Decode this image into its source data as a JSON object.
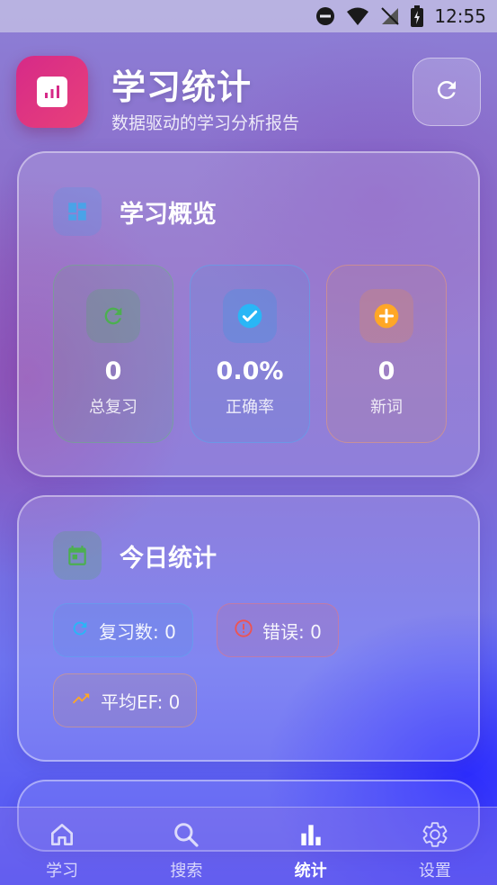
{
  "status_bar": {
    "time": "12:55"
  },
  "header": {
    "title": "学习统计",
    "subtitle": "数据驱动的学习分析报告",
    "logo_icon": "bar-chart-icon",
    "refresh_icon": "refresh-icon"
  },
  "overview": {
    "title": "学习概览",
    "icon": "dashboard-icon",
    "stats": [
      {
        "value": "0",
        "label": "总复习",
        "icon": "refresh-icon",
        "color": "#4caf50"
      },
      {
        "value": "0.0%",
        "label": "正确率",
        "icon": "check-circle-icon",
        "color": "#29b6f6"
      },
      {
        "value": "0",
        "label": "新词",
        "icon": "add-circle-icon",
        "color": "#ffa726"
      }
    ]
  },
  "today": {
    "title": "今日统计",
    "icon": "calendar-icon",
    "chips": [
      {
        "label": "复习数: 0",
        "icon": "refresh-icon",
        "color": "#29b6f6"
      },
      {
        "label": "错误: 0",
        "icon": "error-icon",
        "color": "#ef5350"
      },
      {
        "label": "平均EF: 0",
        "icon": "trending-up-icon",
        "color": "#ffa726"
      }
    ]
  },
  "nav": {
    "items": [
      {
        "label": "学习",
        "icon": "home-icon",
        "active": false
      },
      {
        "label": "搜索",
        "icon": "search-icon",
        "active": false
      },
      {
        "label": "统计",
        "icon": "bar-chart-icon",
        "active": true
      },
      {
        "label": "设置",
        "icon": "gear-icon",
        "active": false
      }
    ]
  }
}
